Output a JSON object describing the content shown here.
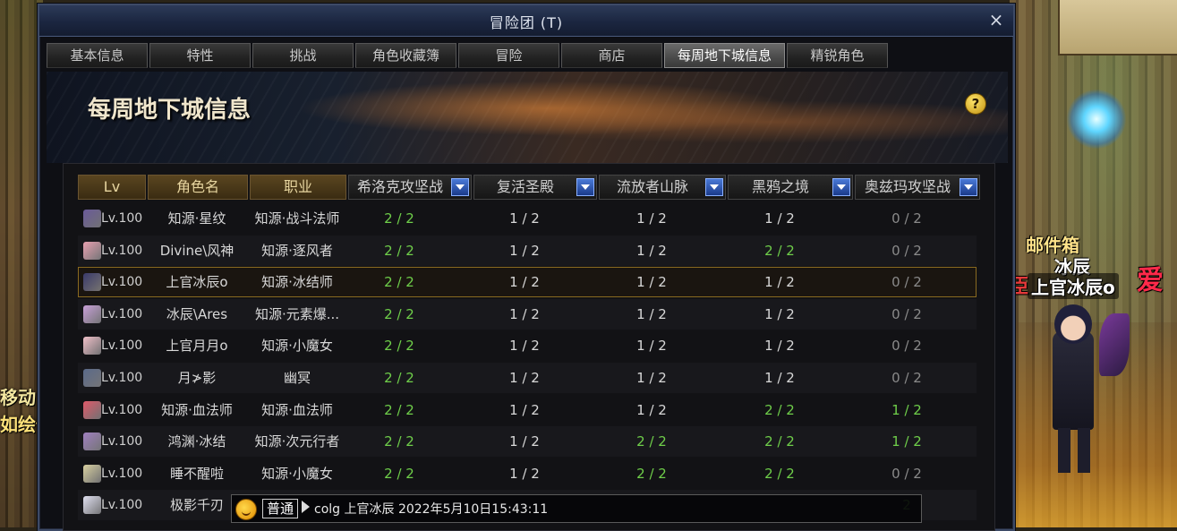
{
  "window": {
    "title": "冒险团 (T)",
    "close_label": "×"
  },
  "tabs": [
    {
      "label": "基本信息",
      "active": false
    },
    {
      "label": "特性",
      "active": false
    },
    {
      "label": "挑战",
      "active": false
    },
    {
      "label": "角色收藏簿",
      "active": false
    },
    {
      "label": "冒险",
      "active": false
    },
    {
      "label": "商店",
      "active": false
    },
    {
      "label": "每周地下城信息",
      "active": true
    },
    {
      "label": "精锐角色",
      "active": false
    }
  ],
  "banner": {
    "title": "每周地下城信息",
    "help_label": "?"
  },
  "table": {
    "headers": [
      "Lv",
      "角色名",
      "职业",
      "希洛克攻坚战",
      "复活圣殿",
      "流放者山脉",
      "黑鸦之境",
      "奥兹玛攻坚战"
    ],
    "rows": [
      {
        "lv": "Lv.100",
        "name": "知源·星纹",
        "job": "知源·战斗法师",
        "d": [
          "2 / 2",
          "1 / 2",
          "1 / 2",
          "1 / 2",
          "0 / 2"
        ],
        "avatar": "#6a5a9a"
      },
      {
        "lv": "Lv.100",
        "name": "Divine\\风神",
        "job": "知源·逐风者",
        "d": [
          "2 / 2",
          "1 / 2",
          "1 / 2",
          "2 / 2",
          "0 / 2"
        ],
        "avatar": "#e8a0b0"
      },
      {
        "lv": "Lv.100",
        "name": "上官冰辰o",
        "job": "知源·冰结师",
        "d": [
          "2 / 2",
          "1 / 2",
          "1 / 2",
          "1 / 2",
          "0 / 2"
        ],
        "avatar": "#3a3a6a"
      },
      {
        "lv": "Lv.100",
        "name": "冰辰\\Ares",
        "job": "知源·元素爆...",
        "d": [
          "2 / 2",
          "1 / 2",
          "1 / 2",
          "1 / 2",
          "0 / 2"
        ],
        "avatar": "#c8a0d8"
      },
      {
        "lv": "Lv.100",
        "name": "上官月月o",
        "job": "知源·小魔女",
        "d": [
          "2 / 2",
          "1 / 2",
          "1 / 2",
          "1 / 2",
          "0 / 2"
        ],
        "avatar": "#f0c0c8"
      },
      {
        "lv": "Lv.100",
        "name": "月≯影",
        "job": "幽冥",
        "d": [
          "2 / 2",
          "1 / 2",
          "1 / 2",
          "1 / 2",
          "0 / 2"
        ],
        "avatar": "#5a6a8a"
      },
      {
        "lv": "Lv.100",
        "name": "知源·血法师",
        "job": "知源·血法师",
        "d": [
          "2 / 2",
          "1 / 2",
          "1 / 2",
          "2 / 2",
          "1 / 2"
        ],
        "avatar": "#e05a6a"
      },
      {
        "lv": "Lv.100",
        "name": "鸿渊·冰结",
        "job": "知源·次元行者",
        "d": [
          "2 / 2",
          "1 / 2",
          "2 / 2",
          "2 / 2",
          "1 / 2"
        ],
        "avatar": "#a080c0"
      },
      {
        "lv": "Lv.100",
        "name": "睡不醒啦",
        "job": "知源·小魔女",
        "d": [
          "2 / 2",
          "1 / 2",
          "2 / 2",
          "2 / 2",
          "0 / 2"
        ],
        "avatar": "#d8d0a0"
      },
      {
        "lv": "Lv.100",
        "name": "极影千刃",
        "job": "",
        "d": [
          "",
          "",
          "",
          "",
          "2"
        ],
        "avatar": "#e0e0f0"
      }
    ]
  },
  "chat": {
    "channel": "普通",
    "message": "colg 上官冰辰 2022年5月10日15:43:11"
  },
  "scene": {
    "left_text_1": "移动",
    "left_text_2": "如绘俐",
    "npc_mailbox": "邮件箱",
    "npc_sub": "冰辰",
    "player_name": "上官冰辰o",
    "red_text": "爱",
    "red_text_2": "臣"
  },
  "colors": {
    "done": "#6fcf4a",
    "partial": "#d8d8d8",
    "zero": "#8a8a8a",
    "highlight_border": "#8a6a20"
  }
}
